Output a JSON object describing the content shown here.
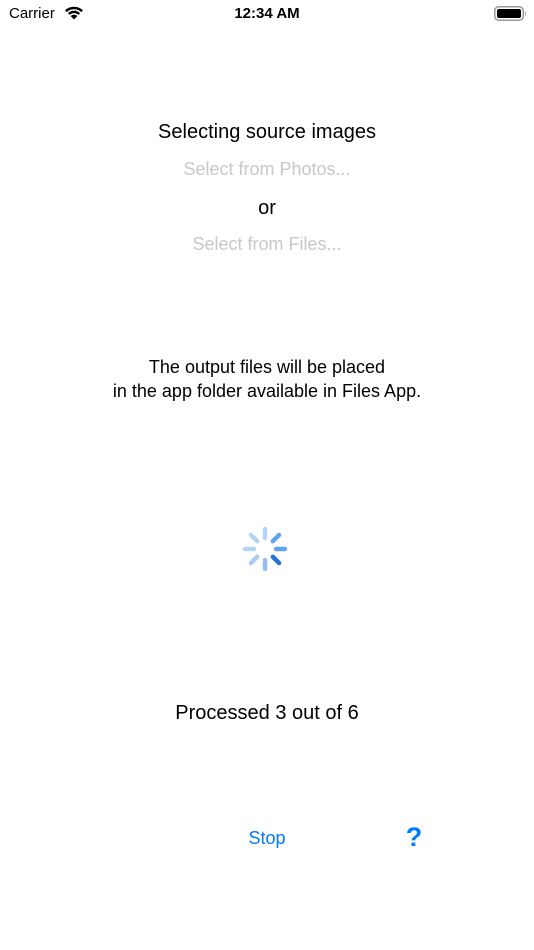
{
  "status_bar": {
    "carrier": "Carrier",
    "time": "12:34 AM",
    "wifi_icon": "wifi-icon",
    "battery_icon": "battery-full-icon"
  },
  "source": {
    "heading": "Selecting source images",
    "photos_link": "Select from Photos...",
    "or_text": "or",
    "files_link": "Select from Files..."
  },
  "info": {
    "line1": "The output files will be placed",
    "line2": "in the app folder available in Files App."
  },
  "progress": {
    "spinner_icon": "activity-spinner-icon",
    "processed": 3,
    "total": 6,
    "text": "Processed 3 out of 6"
  },
  "actions": {
    "stop_label": "Stop",
    "help_label": "?"
  },
  "colors": {
    "accent": "#007aff",
    "disabled_text": "#c7c7cc",
    "text": "#000000",
    "background": "#ffffff"
  }
}
